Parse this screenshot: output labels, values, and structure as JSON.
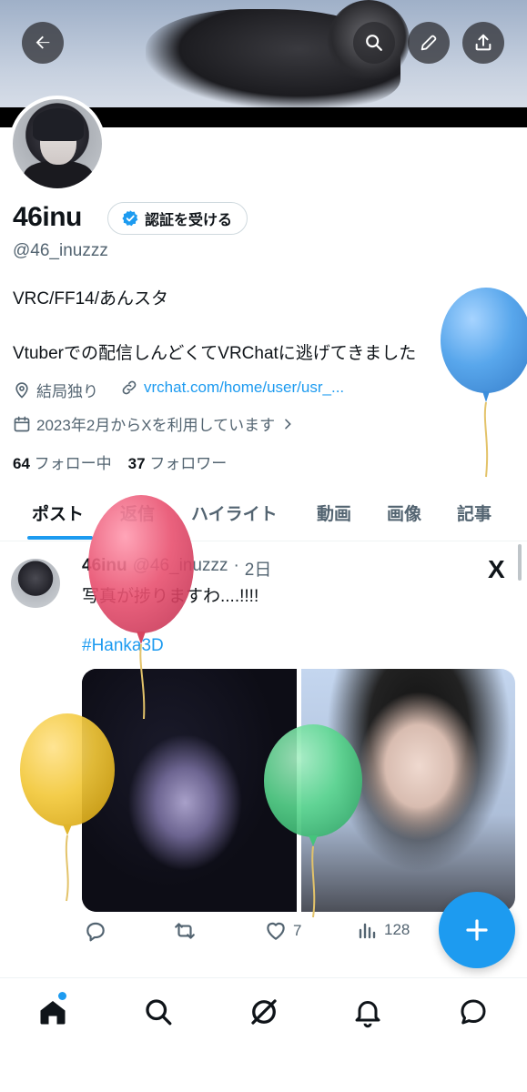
{
  "header": {
    "back_icon": "arrow-left-icon",
    "search_icon": "search-icon",
    "edit_icon": "pencil-icon",
    "share_icon": "share-icon"
  },
  "profile": {
    "name": "46inu",
    "verify_label": "認証を受ける",
    "handle": "@46_inuzzz",
    "bio_line1": "VRC/FF14/あんスタ",
    "bio_line2": "Vtuberでの配信しんどくてVRChatに逃げてきました",
    "location": "結局独り",
    "link": "vrchat.com/home/user/usr_...",
    "joined": "2023年2月からXを利用しています",
    "following_count": "64",
    "following_label": "フォロー中",
    "followers_count": "37",
    "followers_label": "フォロワー"
  },
  "tabs": [
    {
      "label": "ポスト"
    },
    {
      "label": "返信"
    },
    {
      "label": "ハイライト"
    },
    {
      "label": "動画"
    },
    {
      "label": "画像"
    },
    {
      "label": "記事"
    }
  ],
  "post": {
    "author": "46inu",
    "handle": "@46_inuzzz",
    "separator": "·",
    "time": "2日",
    "text": "写真が捗りますわ....!!!!",
    "hashtag": "#Hanka3D",
    "logo": "X",
    "likes": "7",
    "views": "128"
  },
  "colors": {
    "accent": "#1d9bf0",
    "balloon_blue": "#4a9fea",
    "balloon_red": "#e8506f",
    "balloon_yellow": "#f2c83a",
    "balloon_green": "#58d68d"
  },
  "bottom_nav": [
    "home-icon",
    "search-icon",
    "grok-icon",
    "bell-icon",
    "messages-icon"
  ]
}
